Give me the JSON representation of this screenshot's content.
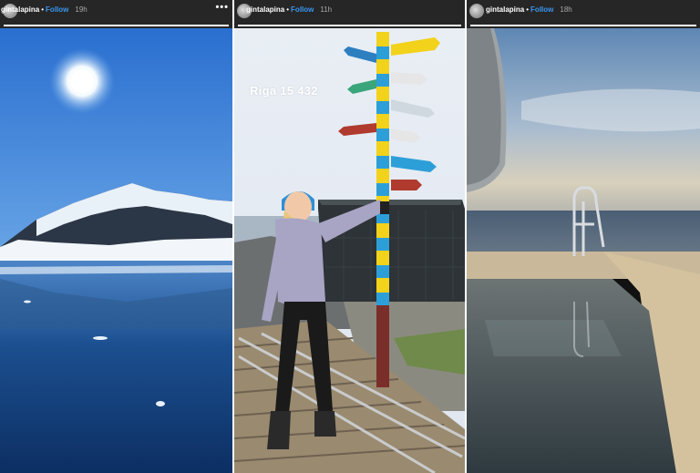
{
  "stories": [
    {
      "username": "gintalapina",
      "follow_label": "Follow",
      "time": "19h",
      "progress": 1.0,
      "more_icon": "more-dots-icon"
    },
    {
      "username": "gintalapina",
      "follow_label": "Follow",
      "time": "11h",
      "progress": 1.0,
      "caption": "Riga 15 432"
    },
    {
      "username": "gintalapina",
      "follow_label": "Follow",
      "time": "18h",
      "progress": 1.0
    }
  ],
  "separator": "•",
  "colors": {
    "header_bg": "#262626",
    "follow": "#3897f0",
    "time": "#a8a8a8"
  }
}
